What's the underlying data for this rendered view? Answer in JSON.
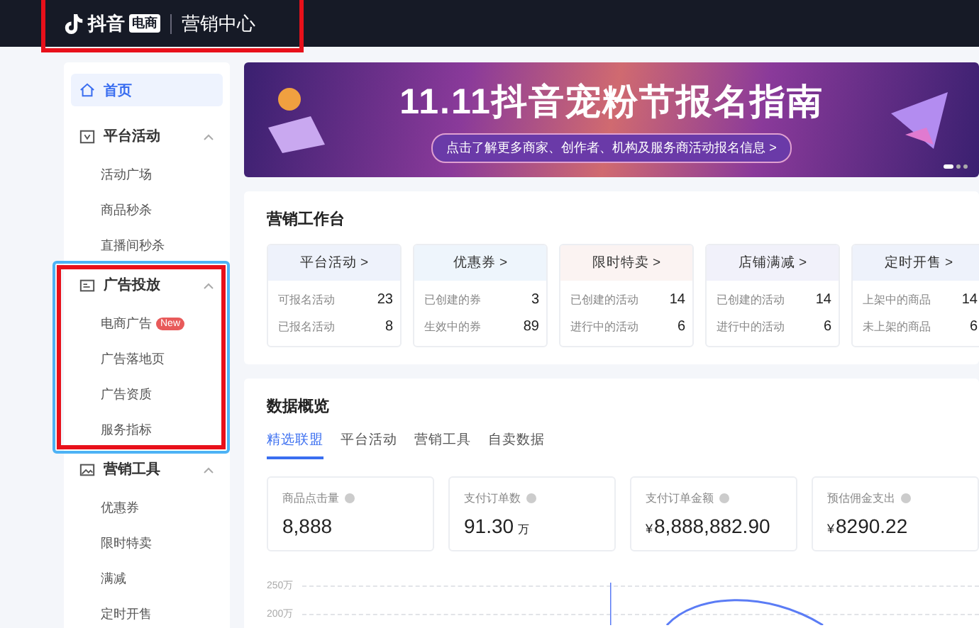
{
  "header": {
    "logo_text": "抖音",
    "logo_badge": "电商",
    "title": "营销中心",
    "highlighted": true
  },
  "sidebar": {
    "items": [
      {
        "kind": "link",
        "label": "首页",
        "selected": true
      },
      {
        "kind": "group",
        "label": "平台活动",
        "expanded": true,
        "highlighted": false,
        "children": [
          {
            "label": "活动广场",
            "selected": false
          },
          {
            "label": "商品秒杀",
            "selected": false
          },
          {
            "label": "直播间秒杀",
            "selected": false
          }
        ]
      },
      {
        "kind": "group",
        "label": "广告投放",
        "expanded": true,
        "highlighted": true,
        "children": [
          {
            "label": "电商广告",
            "badge": "New",
            "selected": false
          },
          {
            "label": "广告落地页",
            "selected": false
          },
          {
            "label": "广告资质",
            "selected": false
          },
          {
            "label": "服务指标",
            "selected": false
          }
        ]
      },
      {
        "kind": "group",
        "label": "营销工具",
        "expanded": true,
        "highlighted": false,
        "children": [
          {
            "label": "优惠券",
            "selected": false
          },
          {
            "label": "限时特卖",
            "selected": false
          },
          {
            "label": "满减",
            "selected": false
          },
          {
            "label": "定时开售",
            "selected": false
          }
        ]
      }
    ]
  },
  "banner": {
    "title": "11.11抖音宠粉节报名指南",
    "subtitle": "点击了解更多商家、创作者、机构及服务商活动报名信息 >",
    "pages": [
      {
        "selected": true
      },
      {
        "selected": false
      },
      {
        "selected": false
      }
    ]
  },
  "workbench": {
    "title": "营销工作台",
    "cards": [
      {
        "title": "平台活动 >",
        "color": "#eef2fb",
        "rows": [
          {
            "label": "可报名活动",
            "value": "23"
          },
          {
            "label": "已报名活动",
            "value": "8"
          }
        ]
      },
      {
        "title": "优惠券 >",
        "color": "#eef5fc",
        "rows": [
          {
            "label": "已创建的券",
            "value": "3"
          },
          {
            "label": "生效中的券",
            "value": "89"
          }
        ]
      },
      {
        "title": "限时特卖 >",
        "color": "#fbf3f2",
        "rows": [
          {
            "label": "已创建的活动",
            "value": "14"
          },
          {
            "label": "进行中的活动",
            "value": "6"
          }
        ]
      },
      {
        "title": "店铺满减 >",
        "color": "#f1f1fa",
        "rows": [
          {
            "label": "已创建的活动",
            "value": "14"
          },
          {
            "label": "进行中的活动",
            "value": "6"
          }
        ]
      },
      {
        "title": "定时开售 >",
        "color": "#eef2fb",
        "rows": [
          {
            "label": "上架中的商品",
            "value": "14"
          },
          {
            "label": "未上架的商品",
            "value": "6"
          }
        ]
      }
    ]
  },
  "overview": {
    "title": "数据概览",
    "tabs": [
      {
        "label": "精选联盟",
        "selected": true
      },
      {
        "label": "平台活动",
        "selected": false
      },
      {
        "label": "营销工具",
        "selected": false
      },
      {
        "label": "自卖数据",
        "selected": false
      }
    ],
    "metrics": [
      {
        "label": "商品点击量",
        "value": "8,888"
      },
      {
        "label": "支付订单数",
        "value": "91.30",
        "unit": "万"
      },
      {
        "label": "支付订单金额",
        "prefix": "¥",
        "value": "8,888,882.90"
      },
      {
        "label": "预估佣金支出",
        "prefix": "¥",
        "value": "8290.22"
      }
    ],
    "chart": {
      "y_labels": [
        "250万",
        "200万"
      ]
    }
  }
}
